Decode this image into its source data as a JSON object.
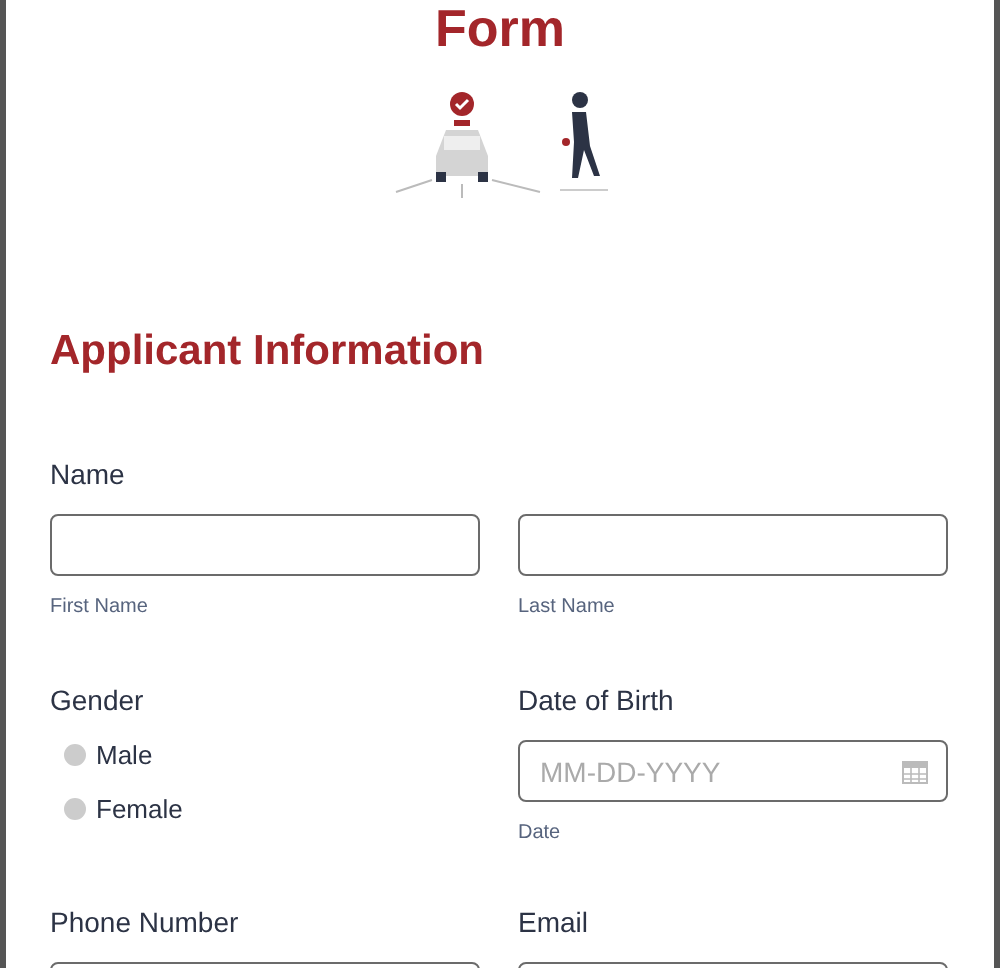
{
  "title": "Form",
  "section_title": "Applicant Information",
  "name": {
    "label": "Name",
    "fields": [
      {
        "sublabel": "First Name"
      },
      {
        "sublabel": "Last Name"
      }
    ]
  },
  "gender": {
    "label": "Gender",
    "options": [
      {
        "label": "Male",
        "selected": false
      },
      {
        "label": "Female",
        "selected": false
      }
    ]
  },
  "date_of_birth": {
    "label": "Date of Birth",
    "placeholder": "MM-DD-YYYY",
    "sublabel": "Date"
  },
  "phone": {
    "label": "Phone Number"
  },
  "email": {
    "label": "Email"
  }
}
